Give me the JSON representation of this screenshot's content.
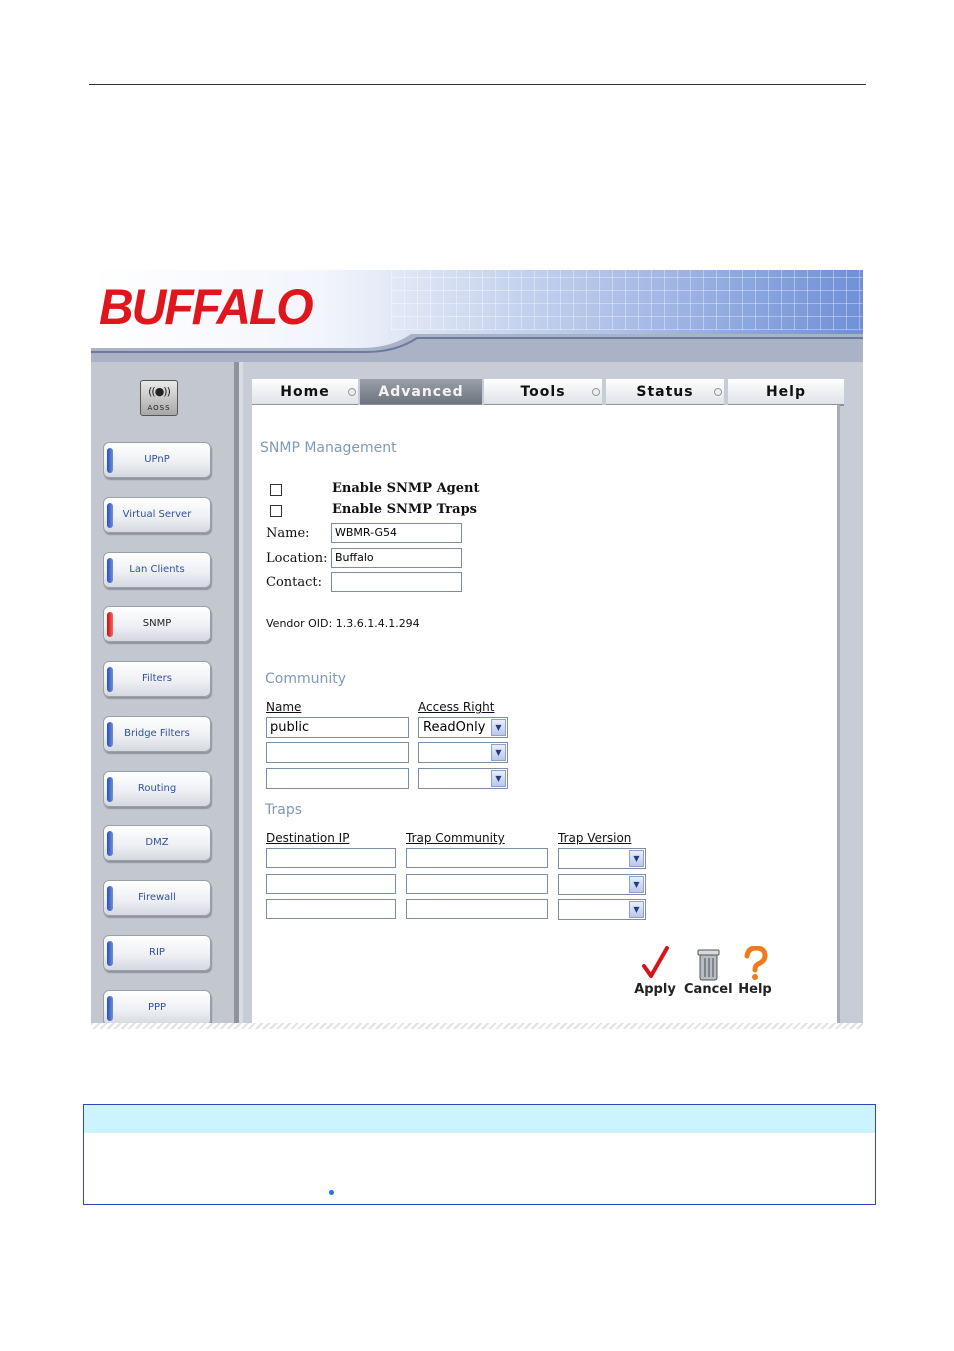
{
  "brand": {
    "logo_text": "BUFFALO",
    "header_script_text": ""
  },
  "aoss": {
    "label": "AOSS"
  },
  "tabs": [
    {
      "label": "Home",
      "active": false
    },
    {
      "label": "Advanced",
      "active": true
    },
    {
      "label": "Tools",
      "active": false
    },
    {
      "label": "Status",
      "active": false
    },
    {
      "label": "Help",
      "active": false
    }
  ],
  "sidebar": {
    "items": [
      {
        "label": "UPnP",
        "active": false
      },
      {
        "label": "Virtual Server",
        "active": false
      },
      {
        "label": "Lan Clients",
        "active": false
      },
      {
        "label": "SNMP",
        "active": true
      },
      {
        "label": "Filters",
        "active": false
      },
      {
        "label": "Bridge Filters",
        "active": false
      },
      {
        "label": "Routing",
        "active": false
      },
      {
        "label": "DMZ",
        "active": false
      },
      {
        "label": "Firewall",
        "active": false
      },
      {
        "label": "RIP",
        "active": false
      },
      {
        "label": "PPP",
        "active": false
      }
    ]
  },
  "snmp": {
    "title": "SNMP Management",
    "enable_agent_label": "Enable SNMP Agent",
    "enable_traps_label": "Enable SNMP Traps",
    "enable_agent_checked": false,
    "enable_traps_checked": false,
    "name_label": "Name:",
    "name_value": "WBMR-G54",
    "location_label": "Location:",
    "location_value": "Buffalo",
    "contact_label": "Contact:",
    "contact_value": "",
    "vendor_oid": "Vendor OID: 1.3.6.1.4.1.294"
  },
  "community": {
    "title": "Community",
    "col_name": "Name",
    "col_access": "Access Right",
    "rows": [
      {
        "name": "public",
        "access": "ReadOnly"
      },
      {
        "name": "",
        "access": ""
      },
      {
        "name": "",
        "access": ""
      }
    ]
  },
  "traps": {
    "title": "Traps",
    "col_dest": "Destination IP",
    "col_community": "Trap Community",
    "col_version": "Trap Version",
    "rows": [
      {
        "dest": "",
        "community": "",
        "version": ""
      },
      {
        "dest": "",
        "community": "",
        "version": ""
      },
      {
        "dest": "",
        "community": "",
        "version": ""
      }
    ]
  },
  "actions": {
    "apply_label": "Apply",
    "cancel_label": "Cancel",
    "help_label": "Help"
  },
  "icons": {
    "apply": "checkmark-icon",
    "cancel": "trash-can-icon",
    "help": "question-mark-icon",
    "dropdown": "chevron-down-icon"
  },
  "colors": {
    "brand_red": "#e0161d",
    "section_title": "#7f9ab7",
    "note_header": "#ccf4fe",
    "note_border": "#3146b5"
  }
}
